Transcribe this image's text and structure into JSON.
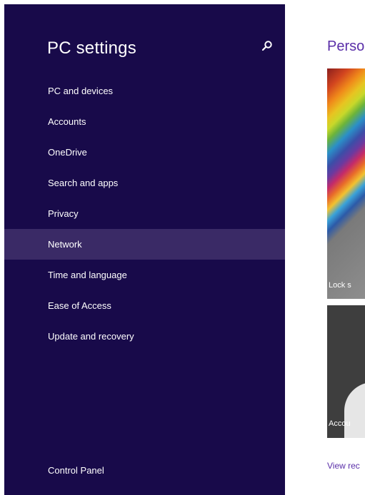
{
  "nav": {
    "title": "PC settings",
    "search_icon": "search-icon",
    "items": [
      {
        "label": "PC and devices",
        "selected": false
      },
      {
        "label": "Accounts",
        "selected": false
      },
      {
        "label": "OneDrive",
        "selected": false
      },
      {
        "label": "Search and apps",
        "selected": false
      },
      {
        "label": "Privacy",
        "selected": false
      },
      {
        "label": "Network",
        "selected": true
      },
      {
        "label": "Time and language",
        "selected": false
      },
      {
        "label": "Ease of Access",
        "selected": false
      },
      {
        "label": "Update and recovery",
        "selected": false
      }
    ],
    "control_panel": "Control Panel"
  },
  "content": {
    "title": "Perso",
    "tiles": [
      {
        "label": "Lock s"
      },
      {
        "label": "Accou"
      }
    ],
    "view_recent": "View rec"
  },
  "colors": {
    "nav_background": "#180a4a",
    "selected_item": "#3a2a66",
    "accent": "#5a2ea8"
  }
}
